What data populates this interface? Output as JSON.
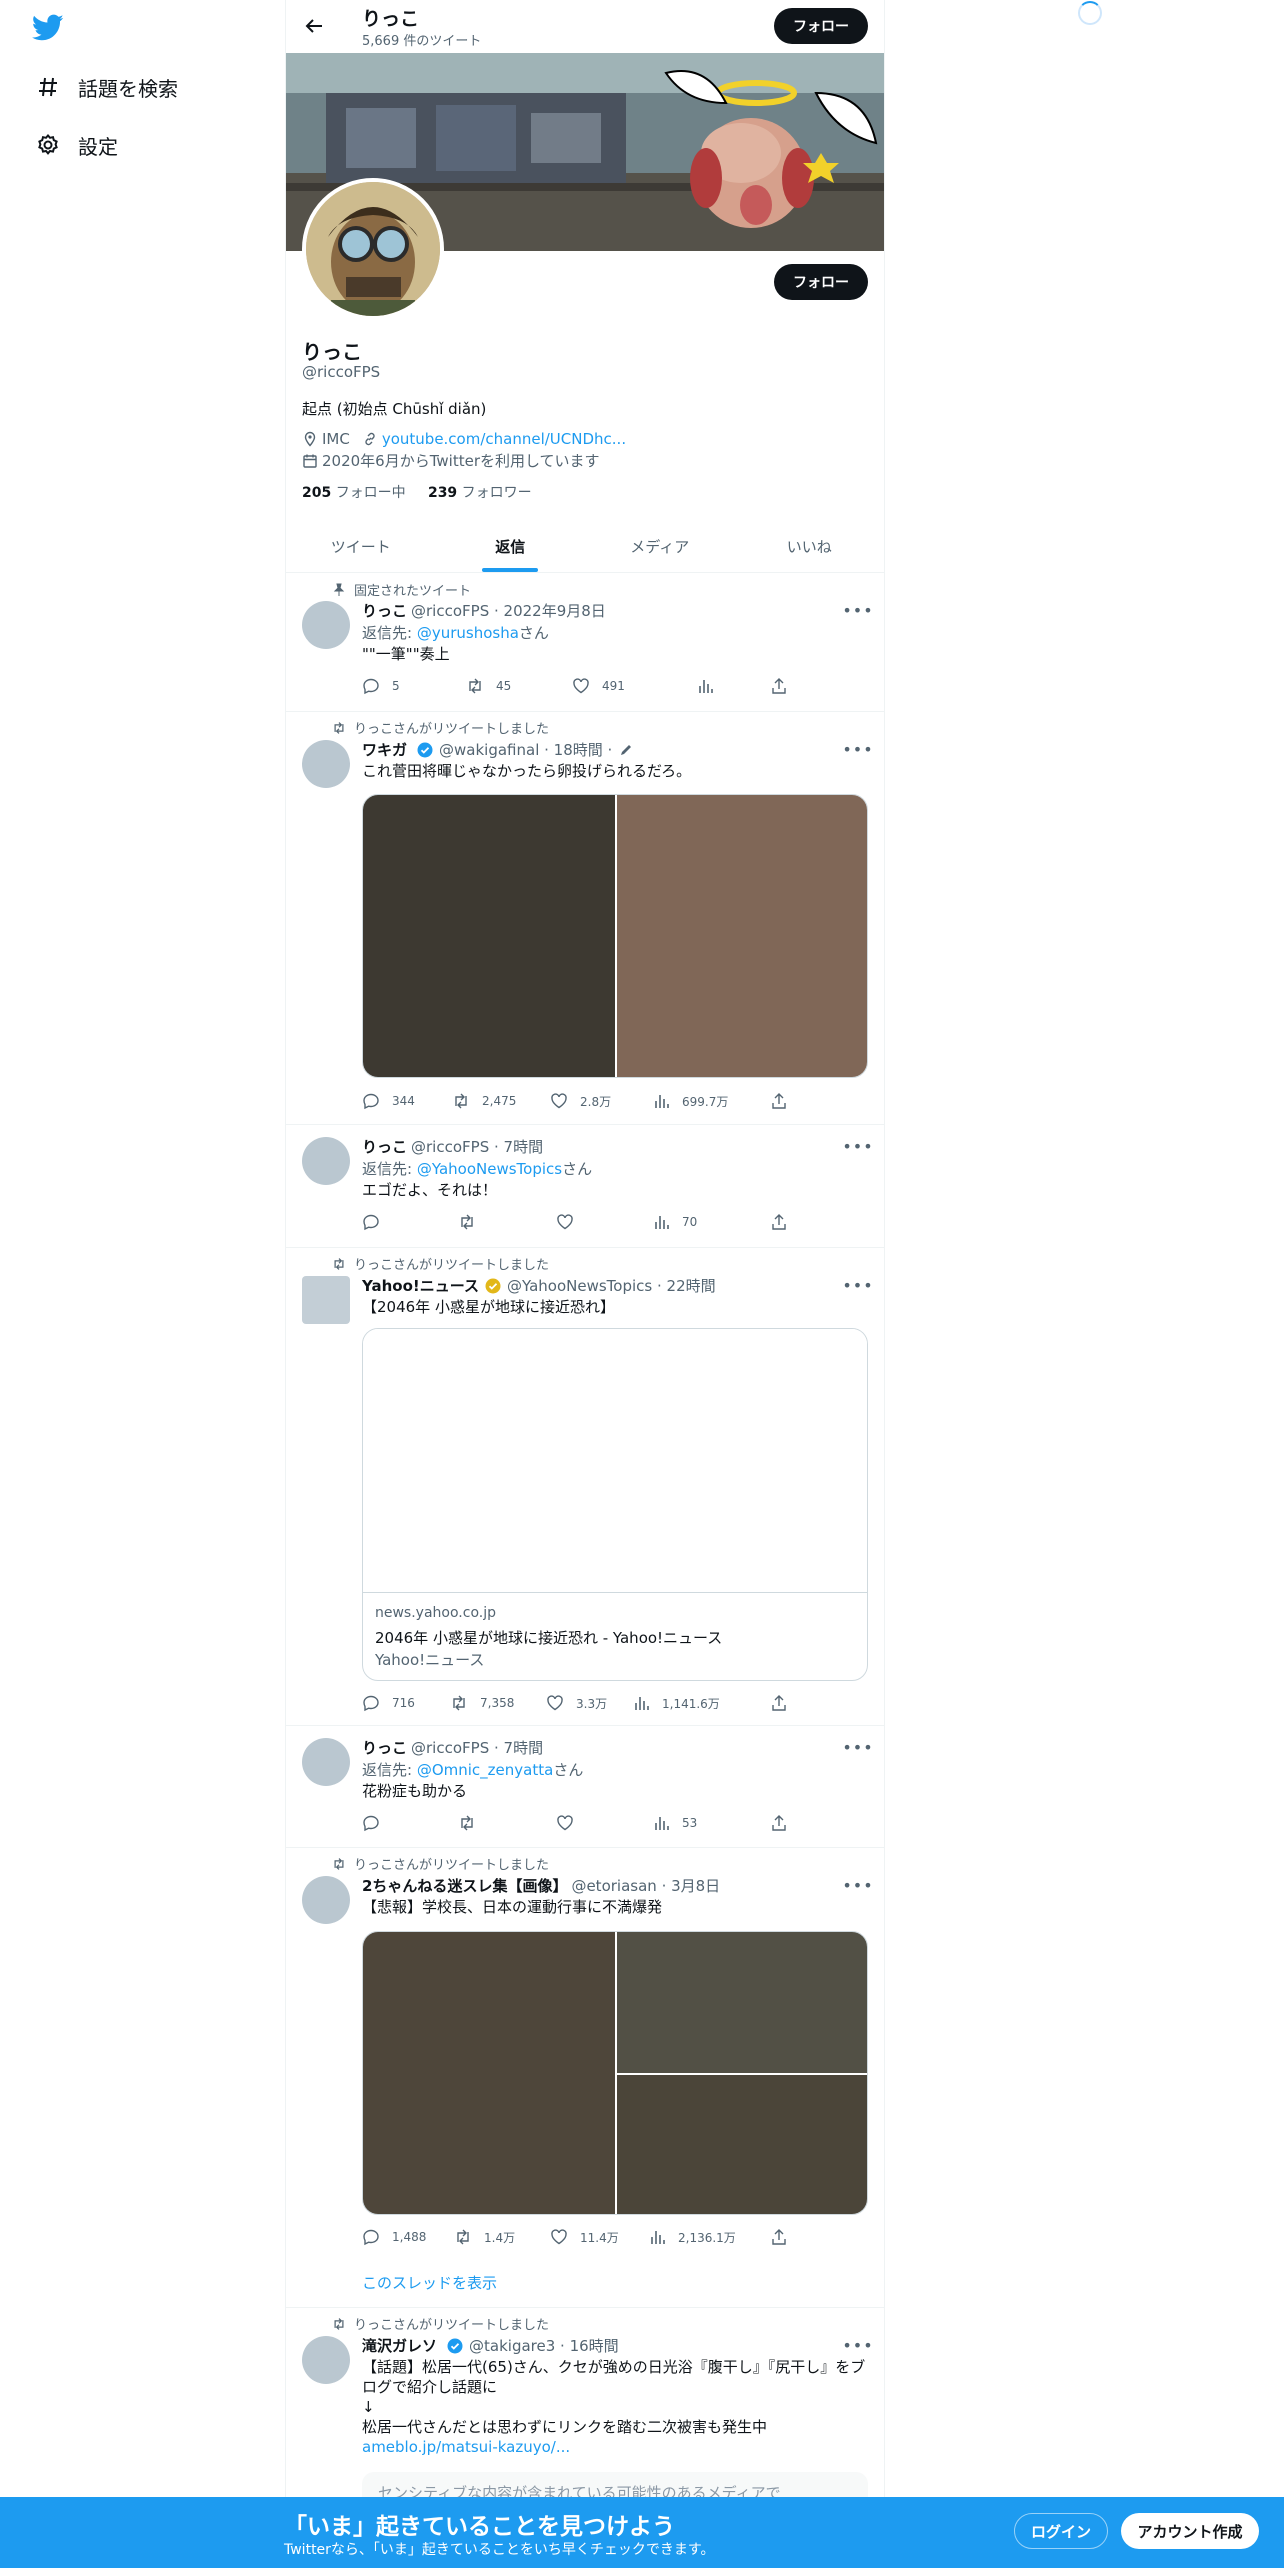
{
  "nav": {
    "explore_label": "話題を検索",
    "settings_label": "設定"
  },
  "profile": {
    "name": "りっこ",
    "tweet_count": "5,669 件のツイート",
    "follow_label": "フォロー",
    "handle": "@riccoFPS",
    "bio": "起点 (初始点 Chūshǐ diǎn)",
    "location": "IMC",
    "url": "youtube.com/channel/UCNDhc...",
    "joined": "2020年6月からTwitterを利用しています",
    "following_count": "205",
    "following_label": "フォロー中",
    "followers_count": "239",
    "followers_label": "フォロワー"
  },
  "tabs": [
    "ツイート",
    "返信",
    "メディア",
    "いいね"
  ],
  "tweets": [
    {
      "context": "固定されたツイート",
      "name": "りっこ",
      "handle": "@riccoFPS",
      "time": "· 2022年9月8日",
      "reply_label": "返信先:",
      "reply_to": "@yurushosha",
      "reply_suffix": "さん",
      "text": "\"\"一筆\"\"奏上",
      "replies": "5",
      "retweets": "45",
      "likes": "491",
      "views": ""
    },
    {
      "context": "りっこさんがリツイートしました",
      "name": "ワキガ",
      "handle": "@wakigafinal",
      "time": "· 18時間 ·",
      "text": "これ菅田将暉じゃなかったら卵投げられるだろ。",
      "replies": "344",
      "retweets": "2,475",
      "likes": "2.8万",
      "views": "699.7万"
    },
    {
      "name": "りっこ",
      "handle": "@riccoFPS",
      "time": "· 7時間",
      "reply_label": "返信先:",
      "reply_to": "@YahooNewsTopics",
      "reply_suffix": "さん",
      "text": "エゴだよ、それは！",
      "replies": "",
      "retweets": "",
      "likes": "",
      "views": "70"
    },
    {
      "context": "りっこさんがリツイートしました",
      "name": "Yahoo!ニュース",
      "handle": "@YahooNewsTopics",
      "time": "· 22時間",
      "text": "【2046年 小惑星が地球に接近恐れ】",
      "card_domain": "news.yahoo.co.jp",
      "card_title": "2046年 小惑星が地球に接近恐れ - Yahoo!ニュース",
      "card_desc": "Yahoo!ニュース",
      "replies": "716",
      "retweets": "7,358",
      "likes": "3.3万",
      "views": "1,141.6万"
    },
    {
      "name": "りっこ",
      "handle": "@riccoFPS",
      "time": "· 7時間",
      "reply_label": "返信先:",
      "reply_to": "@Omnic_zenyatta",
      "reply_suffix": "さん",
      "text": "花粉症も助かる",
      "replies": "",
      "retweets": "",
      "likes": "",
      "views": "53"
    },
    {
      "context": "りっこさんがリツイートしました",
      "name": "2ちゃんねる迷スレ集【画像】",
      "handle": "@etoriasan",
      "time": "· 3月8日",
      "text": "【悲報】学校長、日本の運動行事に不満爆発",
      "replies": "1,488",
      "retweets": "1.4万",
      "likes": "11.4万",
      "views": "2,136.1万",
      "thread_link": "このスレッドを表示"
    },
    {
      "context": "りっこさんがリツイートしました",
      "name": "滝沢ガレソ",
      "handle": "@takigare3",
      "time": "· 16時間",
      "text_line1": "【話題】松居一代(65)さん、クセが強めの日光浴『腹干し』『尻干し』をブ",
      "text_line2": "ログで紹介し話題に",
      "text_line3": "↓",
      "text_line4": "松居一代さんだとは思わずにリンクを踏む二次被害も発生中",
      "link": "ameblo.jp/matsui-kazuyo/...",
      "sensitive": "センシティブな内容が含まれている可能性のあるメディアで"
    }
  ],
  "bottom": {
    "headline": "「いま」起きていることを見つけよう",
    "sub": "Twitterなら、「いま」起きていることをいち早くチェックできます。",
    "login": "ログイン",
    "signup": "アカウント作成"
  }
}
